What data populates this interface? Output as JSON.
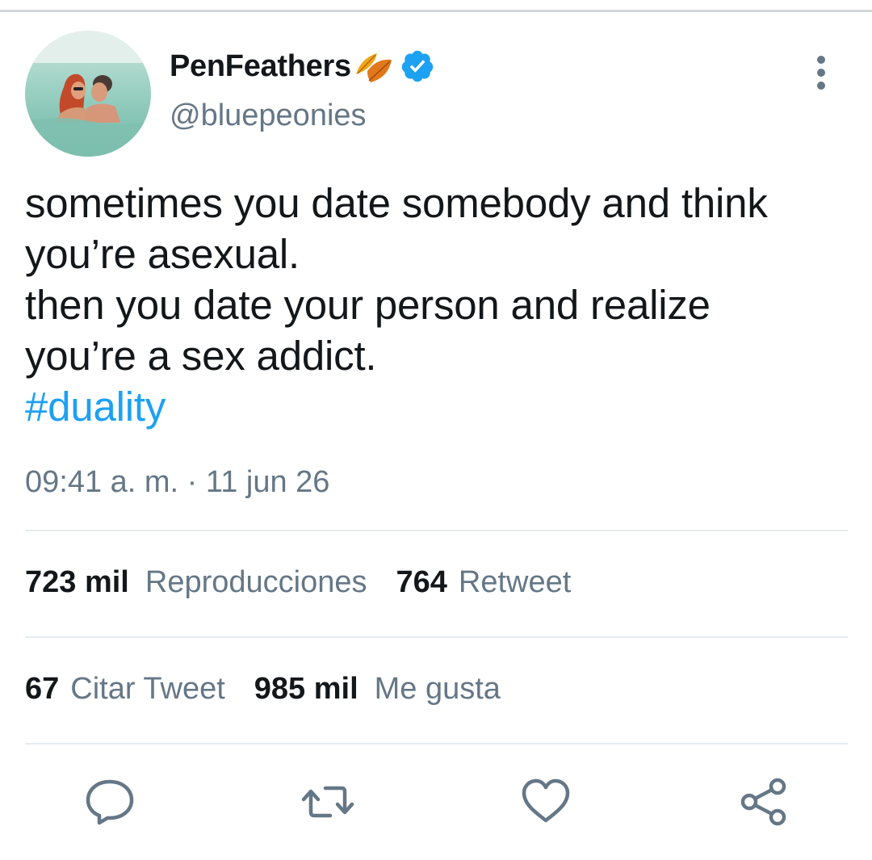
{
  "tweet": {
    "display_name": "PenFeathers",
    "handle": "@bluepeonies",
    "verified": true,
    "text_lines": [
      "sometimes you date somebody and think",
      "you’re asexual.",
      "then you date your person and realize",
      "you’re a sex addict."
    ],
    "hashtag": "#duality",
    "timestamp": "09:41 a. m. · 11 jun 26"
  },
  "stats": {
    "views_count": "723 mil",
    "views_label": "Reproducciones",
    "retweets_count": "764",
    "retweets_label": "Retweet",
    "quotes_count": "67",
    "quotes_label": "Citar Tweet",
    "likes_count": "985 mil",
    "likes_label": "Me gusta"
  },
  "icons": {
    "more": "more-vertical-icon",
    "verified": "verified-badge-icon",
    "emoji": "fallen-leaf-emoji",
    "reply": "reply-icon",
    "retweet": "retweet-icon",
    "like": "heart-icon",
    "share": "share-icon"
  },
  "colors": {
    "accent": "#1da1f2",
    "secondary_text": "#657786",
    "icon_gray": "#657786",
    "divider": "#e6ecf0"
  }
}
